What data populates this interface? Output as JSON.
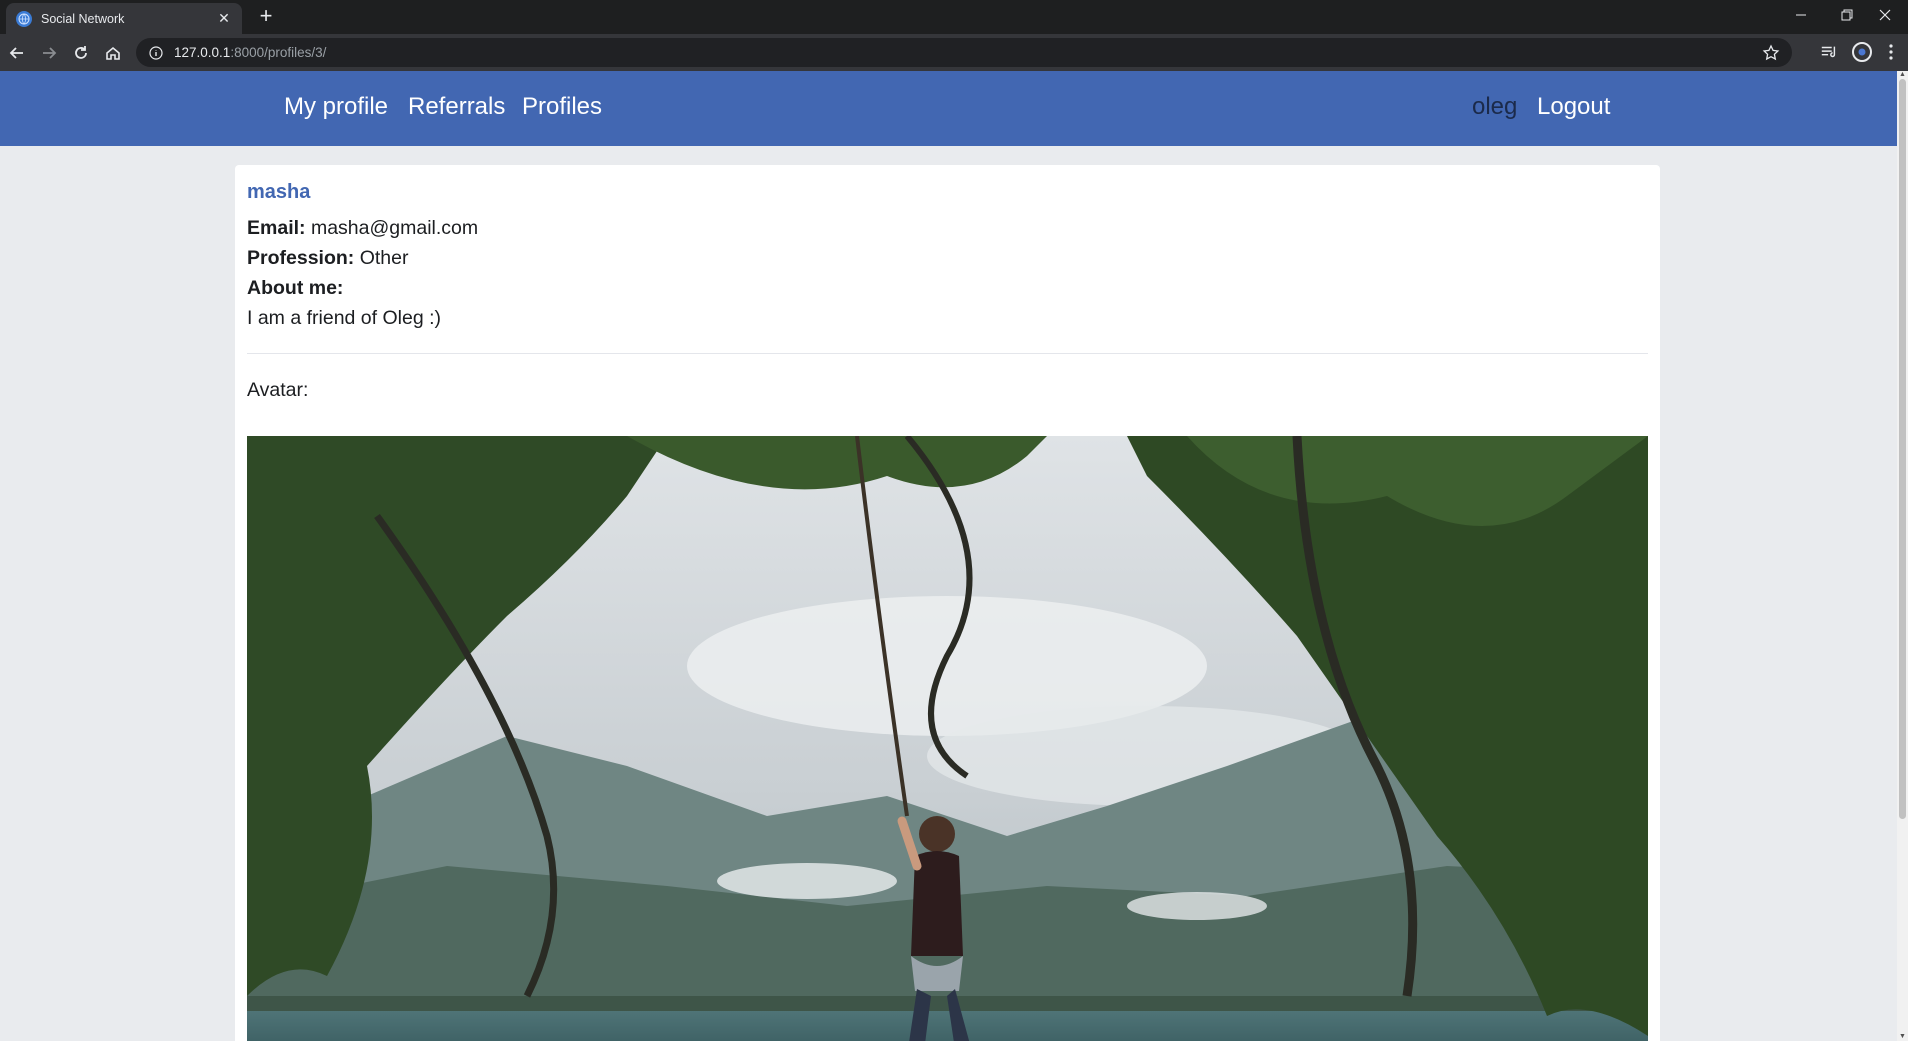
{
  "browser": {
    "tab_title": "Social Network",
    "tab_close": "✕",
    "new_tab": "+",
    "url_host": "127.0.0.1",
    "url_rest": ":8000/profiles/3/"
  },
  "nav": {
    "my_profile": "My profile",
    "referrals": "Referrals",
    "profiles": "Profiles",
    "username": "oleg",
    "logout": "Logout"
  },
  "profile": {
    "name": "masha",
    "email_label": "Email:",
    "email": "masha@gmail.com",
    "profession_label": "Profession:",
    "profession": "Other",
    "about_label": "About me:",
    "about": "I am a friend of Oleg :)",
    "avatar_label": "Avatar:"
  },
  "colors": {
    "navbar": "#4267b2",
    "username_link": "#4267b2",
    "page_bg": "#e9ebee"
  }
}
